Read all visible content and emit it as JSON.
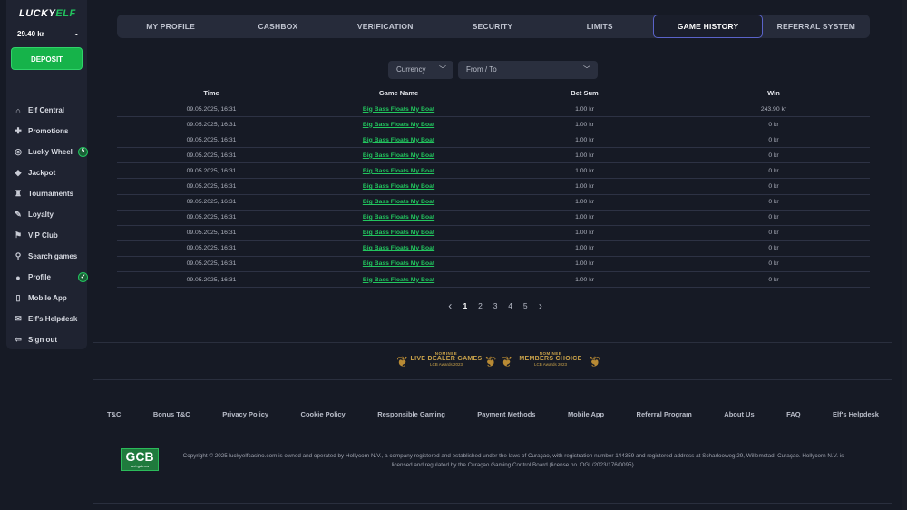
{
  "sidebar": {
    "logo": {
      "part1": "LUCKY",
      "part2": "ELF"
    },
    "balance": "29.40 kr",
    "deposit_label": "DEPOSIT",
    "items": [
      {
        "label": "Elf Central",
        "icon": "home-icon"
      },
      {
        "label": "Promotions",
        "icon": "gift-icon"
      },
      {
        "label": "Lucky Wheel",
        "icon": "wheel-icon",
        "badge": "5"
      },
      {
        "label": "Jackpot",
        "icon": "diamond-icon"
      },
      {
        "label": "Tournaments",
        "icon": "trophy-icon"
      },
      {
        "label": "Loyalty",
        "icon": "tag-icon"
      },
      {
        "label": "VIP Club",
        "icon": "flag-icon"
      },
      {
        "label": "Search games",
        "icon": "search-icon"
      },
      {
        "label": "Profile",
        "icon": "user-icon",
        "check": true
      },
      {
        "label": "Mobile App",
        "icon": "phone-icon"
      },
      {
        "label": "Elf's Helpdesk",
        "icon": "chat-icon"
      },
      {
        "label": "Sign out",
        "icon": "sign-out-icon"
      }
    ]
  },
  "tabs": [
    {
      "label": "MY PROFILE"
    },
    {
      "label": "CASHBOX"
    },
    {
      "label": "VERIFICATION"
    },
    {
      "label": "SECURITY"
    },
    {
      "label": "LIMITS"
    },
    {
      "label": "GAME HISTORY",
      "active": true
    },
    {
      "label": "REFERRAL SYSTEM"
    }
  ],
  "filters": {
    "currency": "Currency",
    "date": "From / To"
  },
  "table": {
    "headers": {
      "time": "Time",
      "game": "Game Name",
      "bet": "Bet Sum",
      "win": "Win"
    },
    "rows": [
      {
        "time": "09.05.2025, 16:31",
        "game": "Big Bass Floats My Boat",
        "bet": "1.00 kr",
        "win": "243.90 kr"
      },
      {
        "time": "09.05.2025, 16:31",
        "game": "Big Bass Floats My Boat",
        "bet": "1.00 kr",
        "win": "0 kr"
      },
      {
        "time": "09.05.2025, 16:31",
        "game": "Big Bass Floats My Boat",
        "bet": "1.00 kr",
        "win": "0 kr"
      },
      {
        "time": "09.05.2025, 16:31",
        "game": "Big Bass Floats My Boat",
        "bet": "1.00 kr",
        "win": "0 kr"
      },
      {
        "time": "09.05.2025, 16:31",
        "game": "Big Bass Floats My Boat",
        "bet": "1.00 kr",
        "win": "0 kr"
      },
      {
        "time": "09.05.2025, 16:31",
        "game": "Big Bass Floats My Boat",
        "bet": "1.00 kr",
        "win": "0 kr"
      },
      {
        "time": "09.05.2025, 16:31",
        "game": "Big Bass Floats My Boat",
        "bet": "1.00 kr",
        "win": "0 kr"
      },
      {
        "time": "09.05.2025, 16:31",
        "game": "Big Bass Floats My Boat",
        "bet": "1.00 kr",
        "win": "0 kr"
      },
      {
        "time": "09.05.2025, 16:31",
        "game": "Big Bass Floats My Boat",
        "bet": "1.00 kr",
        "win": "0 kr"
      },
      {
        "time": "09.05.2025, 16:31",
        "game": "Big Bass Floats My Boat",
        "bet": "1.00 kr",
        "win": "0 kr"
      },
      {
        "time": "09.05.2025, 16:31",
        "game": "Big Bass Floats My Boat",
        "bet": "1.00 kr",
        "win": "0 kr"
      },
      {
        "time": "09.05.2025, 16:31",
        "game": "Big Bass Floats My Boat",
        "bet": "1.00 kr",
        "win": "0 kr"
      }
    ]
  },
  "pagination": {
    "pages": [
      "1",
      "2",
      "3",
      "4",
      "5"
    ],
    "current": "1",
    "prev": "‹",
    "next": "›"
  },
  "awards": [
    {
      "nominee": "NOMINEE",
      "title": "LIVE DEALER GAMES",
      "sub": "LCB Awards 2023"
    },
    {
      "nominee": "NOMINEE",
      "title": "MEMBERS CHOICE",
      "sub": "LCB Awards 2023"
    }
  ],
  "footer": {
    "links": [
      "T&C",
      "Bonus T&C",
      "Privacy Policy",
      "Cookie Policy",
      "Responsible Gaming",
      "Payment Methods",
      "Mobile App",
      "Referral Program",
      "About Us",
      "FAQ",
      "Elf's Helpdesk"
    ],
    "gcb": {
      "big": "GCB",
      "small": "cert.gcb.cw"
    },
    "copyright_line1": "Copyright © 2025 luckyelfcasino.com is owned and operated by Hollycorn N.V., a company registered and established under the laws of Curaçao, with registration number 144359 and registered address at Scharlooweg 29, Willemstad, Curaçao. Hollycorn N.V. is",
    "copyright_line2": "licensed and regulated by the Curaçao Gaming Control Board (license no. OGL/2023/176/0095)."
  },
  "colors": {
    "accent": "#22c55e",
    "tab_active_border": "#5a63c9",
    "background": "#161a25"
  }
}
